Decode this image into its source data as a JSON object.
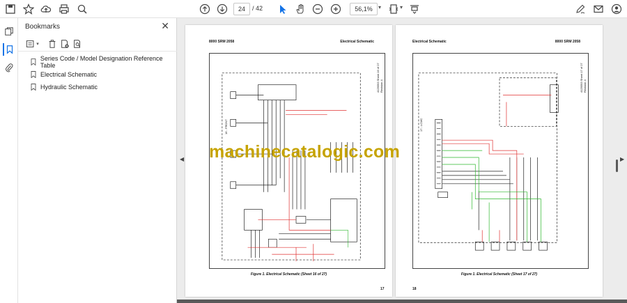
{
  "toolbar": {
    "page_current": "24",
    "page_total": "/ 42",
    "zoom": "56,1%",
    "icons": [
      "save-icon",
      "star-icon",
      "upload-icon",
      "print-icon",
      "zoom-search-icon",
      "page-up-icon",
      "page-down-icon",
      "select-arrow-icon",
      "hand-icon",
      "zoom-out-icon",
      "zoom-in-icon",
      "page-fit-icon",
      "scroll-mode-icon",
      "edit-sign-icon",
      "mail-icon",
      "account-icon"
    ]
  },
  "rail": {
    "icons": [
      "pages-icon",
      "bookmark-icon",
      "attachment-icon"
    ]
  },
  "bookmarks": {
    "title": "Bookmarks",
    "close": "✕",
    "items": [
      {
        "label": "Series Code / Model Designation Reference Table"
      },
      {
        "label": "Electrical Schematic"
      },
      {
        "label": "Hydraulic Schematic"
      }
    ]
  },
  "left_page": {
    "header_left": "8000 SRM 2058",
    "header_right": "Electrical Schematic",
    "side_info": "4129593 Sheet 16 of 27 Revision 4",
    "side_tag": "16 - FRONT",
    "caption": "Figure 1. Electrical Schematic (Sheet 16 of 27)",
    "page_num": "17"
  },
  "right_page": {
    "header_left": "Electrical Schematic",
    "header_right": "8000 SRM 2058",
    "side_info": "4129593 Sheet 17 of 27 Revision 4",
    "side_tag": "17 - LCMC",
    "caption": "Figure 1. Electrical Schematic (Sheet 17 of 27)",
    "page_num": "18"
  },
  "watermark": "machinecatalogic.com",
  "colors": {
    "accent": "#1473e6",
    "watermark": "#c6a300",
    "wire_red": "#e03030",
    "wire_green": "#2eb82e",
    "wire_black": "#222222"
  }
}
